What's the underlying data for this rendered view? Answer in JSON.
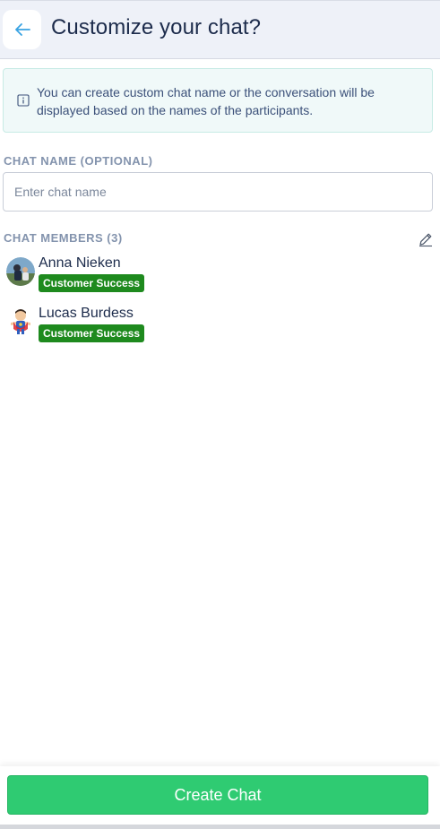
{
  "header": {
    "title": "Customize your chat?",
    "back_icon": "arrow-left-icon",
    "accent": "#3aa3e3"
  },
  "info": {
    "icon": "info-icon",
    "text": "You can create custom chat name or the conversation will be displayed based on the names of the participants."
  },
  "chat_name": {
    "label": "CHAT NAME (OPTIONAL)",
    "placeholder": "Enter chat name",
    "value": ""
  },
  "members": {
    "label": "CHAT MEMBERS (3)",
    "edit_icon": "pencil-icon",
    "items": [
      {
        "name": "Anna Nieken",
        "role": "Customer Success",
        "avatar": "photo-avatar"
      },
      {
        "name": "Lucas Burdess",
        "role": "Customer Success",
        "avatar": "cartoon-avatar"
      }
    ]
  },
  "footer": {
    "create_label": "Create Chat",
    "button_color": "#2fcb72"
  }
}
